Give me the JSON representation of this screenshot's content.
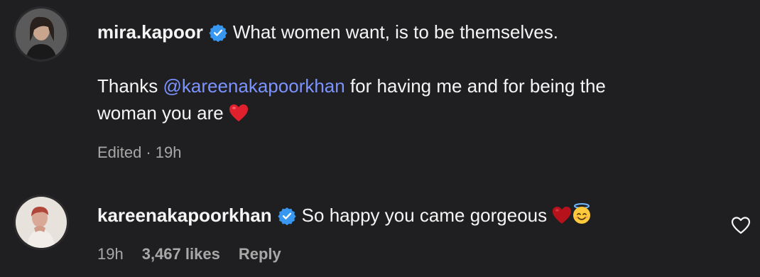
{
  "comments": [
    {
      "username": "mira.kapoor",
      "text_line1": "What women want, is to be themselves.",
      "text_line2_prefix": "Thanks ",
      "mention": "@kareenakapoorkhan",
      "text_line2_suffix": " for having me and for being the",
      "text_line3": "woman you are",
      "edited": "Edited",
      "separator": "·",
      "time": "19h",
      "verified": true,
      "emoji": [
        "red-heart"
      ]
    },
    {
      "username": "kareenakapoorkhan",
      "text": "So happy you came gorgeous",
      "time": "19h",
      "likes": "3,467 likes",
      "reply": "Reply",
      "verified": true,
      "emoji": [
        "red-heart",
        "smiling-face-with-halo"
      ]
    }
  ],
  "colors": {
    "background": "#1f1f21",
    "mention": "#7b93ff",
    "verified": "#3897f0",
    "meta": "#a8a8a8"
  }
}
